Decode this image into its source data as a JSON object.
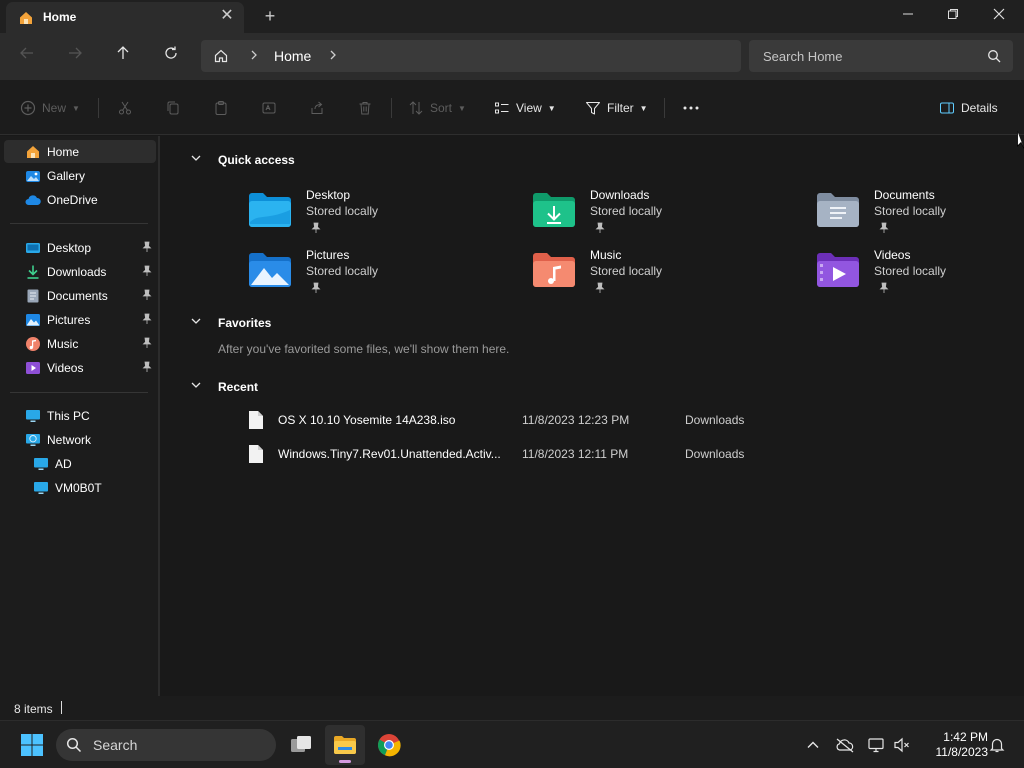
{
  "window": {
    "tab_title": "Home",
    "tab_close": "✕",
    "new_tab": "+",
    "minimize": "—",
    "maximize": "❐",
    "close": "✕"
  },
  "address": {
    "breadcrumb": "Home",
    "search_placeholder": "Search Home"
  },
  "commands": {
    "new": "New",
    "sort": "Sort",
    "view": "View",
    "filter": "Filter",
    "details": "Details"
  },
  "nav": {
    "top": [
      {
        "label": "Home",
        "icon": "home-icon"
      },
      {
        "label": "Gallery",
        "icon": "gallery-icon"
      },
      {
        "label": "OneDrive",
        "icon": "onedrive-cloud-icon"
      }
    ],
    "pinned": [
      {
        "label": "Desktop",
        "icon": "desktop-folder-icon"
      },
      {
        "label": "Downloads",
        "icon": "downloads-arrow-icon"
      },
      {
        "label": "Documents",
        "icon": "documents-icon"
      },
      {
        "label": "Pictures",
        "icon": "pictures-icon"
      },
      {
        "label": "Music",
        "icon": "music-icon"
      },
      {
        "label": "Videos",
        "icon": "videos-icon"
      }
    ],
    "devices": [
      {
        "label": "This PC",
        "icon": "monitor-icon"
      },
      {
        "label": "Network",
        "icon": "network-globe-icon"
      },
      {
        "label": "AD",
        "icon": "monitor-icon"
      },
      {
        "label": "VM0B0T",
        "icon": "monitor-icon"
      }
    ]
  },
  "sections": {
    "quick_access": "Quick access",
    "favorites": "Favorites",
    "favorites_empty": "After you've favorited some files, we'll show them here.",
    "recent": "Recent"
  },
  "quick_access": [
    {
      "name": "Desktop",
      "status": "Stored locally"
    },
    {
      "name": "Downloads",
      "status": "Stored locally"
    },
    {
      "name": "Documents",
      "status": "Stored locally"
    },
    {
      "name": "Pictures",
      "status": "Stored locally"
    },
    {
      "name": "Music",
      "status": "Stored locally"
    },
    {
      "name": "Videos",
      "status": "Stored locally"
    }
  ],
  "recent": [
    {
      "name": "OS X 10.10 Yosemite 14A238.iso",
      "date": "11/8/2023 12:23 PM",
      "location": "Downloads"
    },
    {
      "name": "Windows.Tiny7.Rev01.Unattended.Activ...",
      "date": "11/8/2023 12:11 PM",
      "location": "Downloads"
    }
  ],
  "status": {
    "item_count": "8 items"
  },
  "taskbar": {
    "search_label": "Search",
    "time": "1:42 PM",
    "date": "11/8/2023"
  },
  "colors": {
    "accent": "#60cdff",
    "folder_yellow": "#f4c84a",
    "window_bg": "#191919"
  }
}
